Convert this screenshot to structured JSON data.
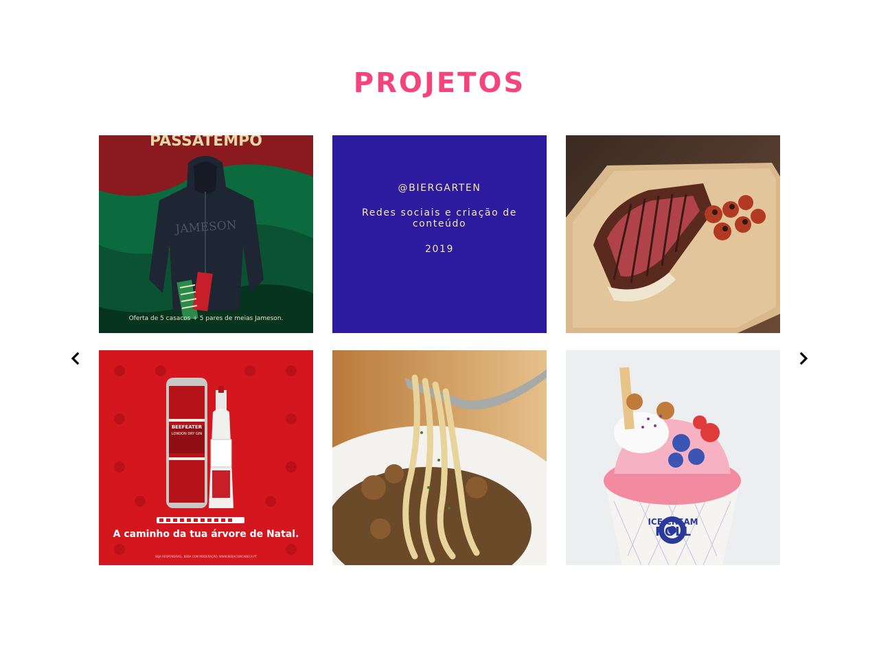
{
  "section": {
    "title": "PROJETOS"
  },
  "projects": [
    {
      "name": "jameson",
      "image_text": {
        "headline": "PASSATEMPO",
        "brand": "JAMESON",
        "caption": "Oferta de 5 casacos + 5 pares de meias Jameson."
      }
    },
    {
      "name": "biergarten",
      "handle": "@BIERGARTEN",
      "description": "Redes sociais e criação de conteúdo",
      "year": "2019"
    },
    {
      "name": "steak"
    },
    {
      "name": "beefeater",
      "image_text": {
        "brand": "BEEFEATER",
        "sub": "LONDON DRY GIN",
        "caption": "A caminho da tua árvore de Natal.",
        "fineprint": "SEJA RESPONSÁVEL. BEBA COM MODERAÇÃO. WWW.BEBACOMCABECA.PT"
      }
    },
    {
      "name": "pasta"
    },
    {
      "name": "ice-cream-roll",
      "image_text": {
        "line1": "ICE CREAM",
        "line2": "ROLL"
      }
    }
  ],
  "carousel": {
    "prev_icon": "chevron-left-icon",
    "next_icon": "chevron-right-icon"
  },
  "colors": {
    "title": "#f5447c",
    "info_bg": "#2c1b9e",
    "info_text": "#f4ecb0"
  }
}
